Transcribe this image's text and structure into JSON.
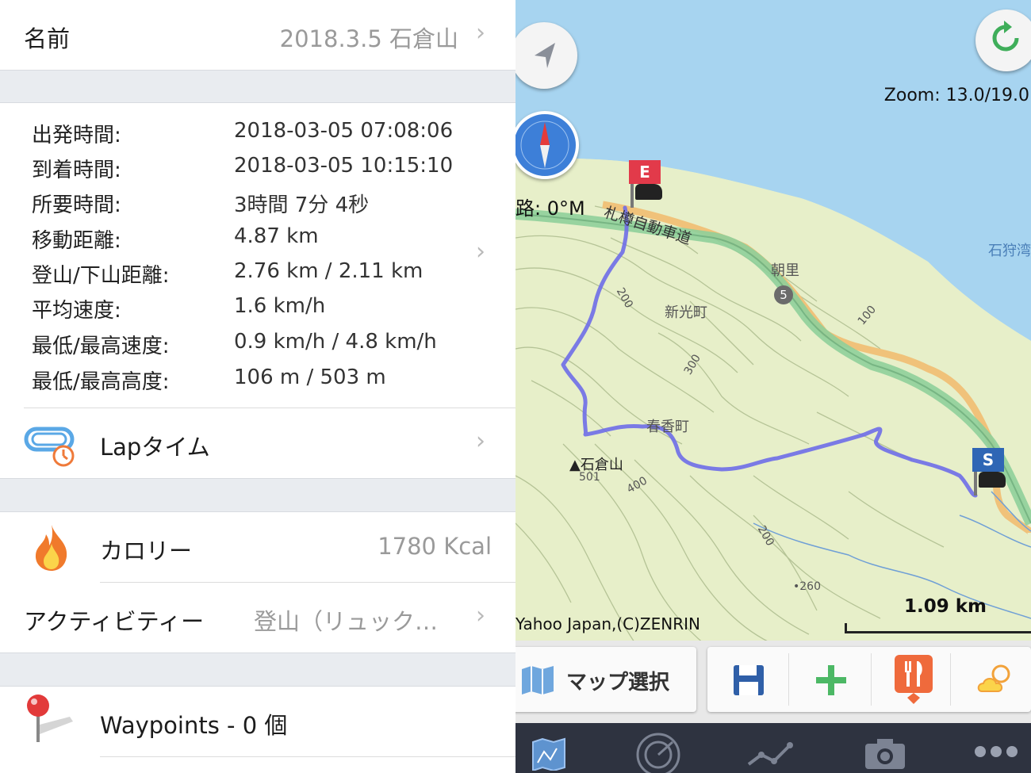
{
  "name_row": {
    "label": "名前",
    "value": "2018.3.5 石倉山"
  },
  "stats": [
    {
      "key": "出発時間:",
      "value": "2018-03-05 07:08:06"
    },
    {
      "key": "到着時間:",
      "value": "2018-03-05 10:15:10"
    },
    {
      "key": "所要時間:",
      "value": "3時間 7分 4秒"
    },
    {
      "key": "移動距離:",
      "value": "4.87 km"
    },
    {
      "key": "登山/下山距離:",
      "value": "2.76 km / 2.11 km"
    },
    {
      "key": "平均速度:",
      "value": "1.6 km/h"
    },
    {
      "key": "最低/最高速度:",
      "value": "0.9 km/h / 4.8 km/h"
    },
    {
      "key": "最低/最高高度:",
      "value": "106 m / 503 m"
    }
  ],
  "lap": {
    "label": "Lapタイム"
  },
  "calorie": {
    "label": "カロリー",
    "value": "1780 Kcal"
  },
  "activity": {
    "label": "アクティビティー",
    "value": "登山（リュック…"
  },
  "waypoints": {
    "label": "Waypoints - 0 個"
  },
  "map": {
    "zoom": "Zoom: 13.0/19.0",
    "route_distance": "路: 0°M",
    "credit": "Yahoo Japan,(C)ZENRIN",
    "scale": "1.09 km",
    "start_marker": "S",
    "end_marker": "E",
    "labels": {
      "expressway": "札樽自動車道",
      "asari": "朝里",
      "shinko": "新光町",
      "haruka": "春香町",
      "ishikura": "▲石倉山",
      "ishikura_elev": "501",
      "bay": "石狩湾",
      "route5": "5",
      "contour_200a": "200",
      "contour_300": "300",
      "contour_400": "400",
      "contour_200b": "200",
      "contour_100": "100",
      "spot_260": "•260"
    }
  },
  "toolbar": {
    "map_select": "マップ選択"
  },
  "colors": {
    "route": "#6e6de8",
    "sea": "#a7d4f0",
    "land": "#e7efc9",
    "road_orange": "#f0c27a",
    "highway_green": "#8fcf9a"
  }
}
